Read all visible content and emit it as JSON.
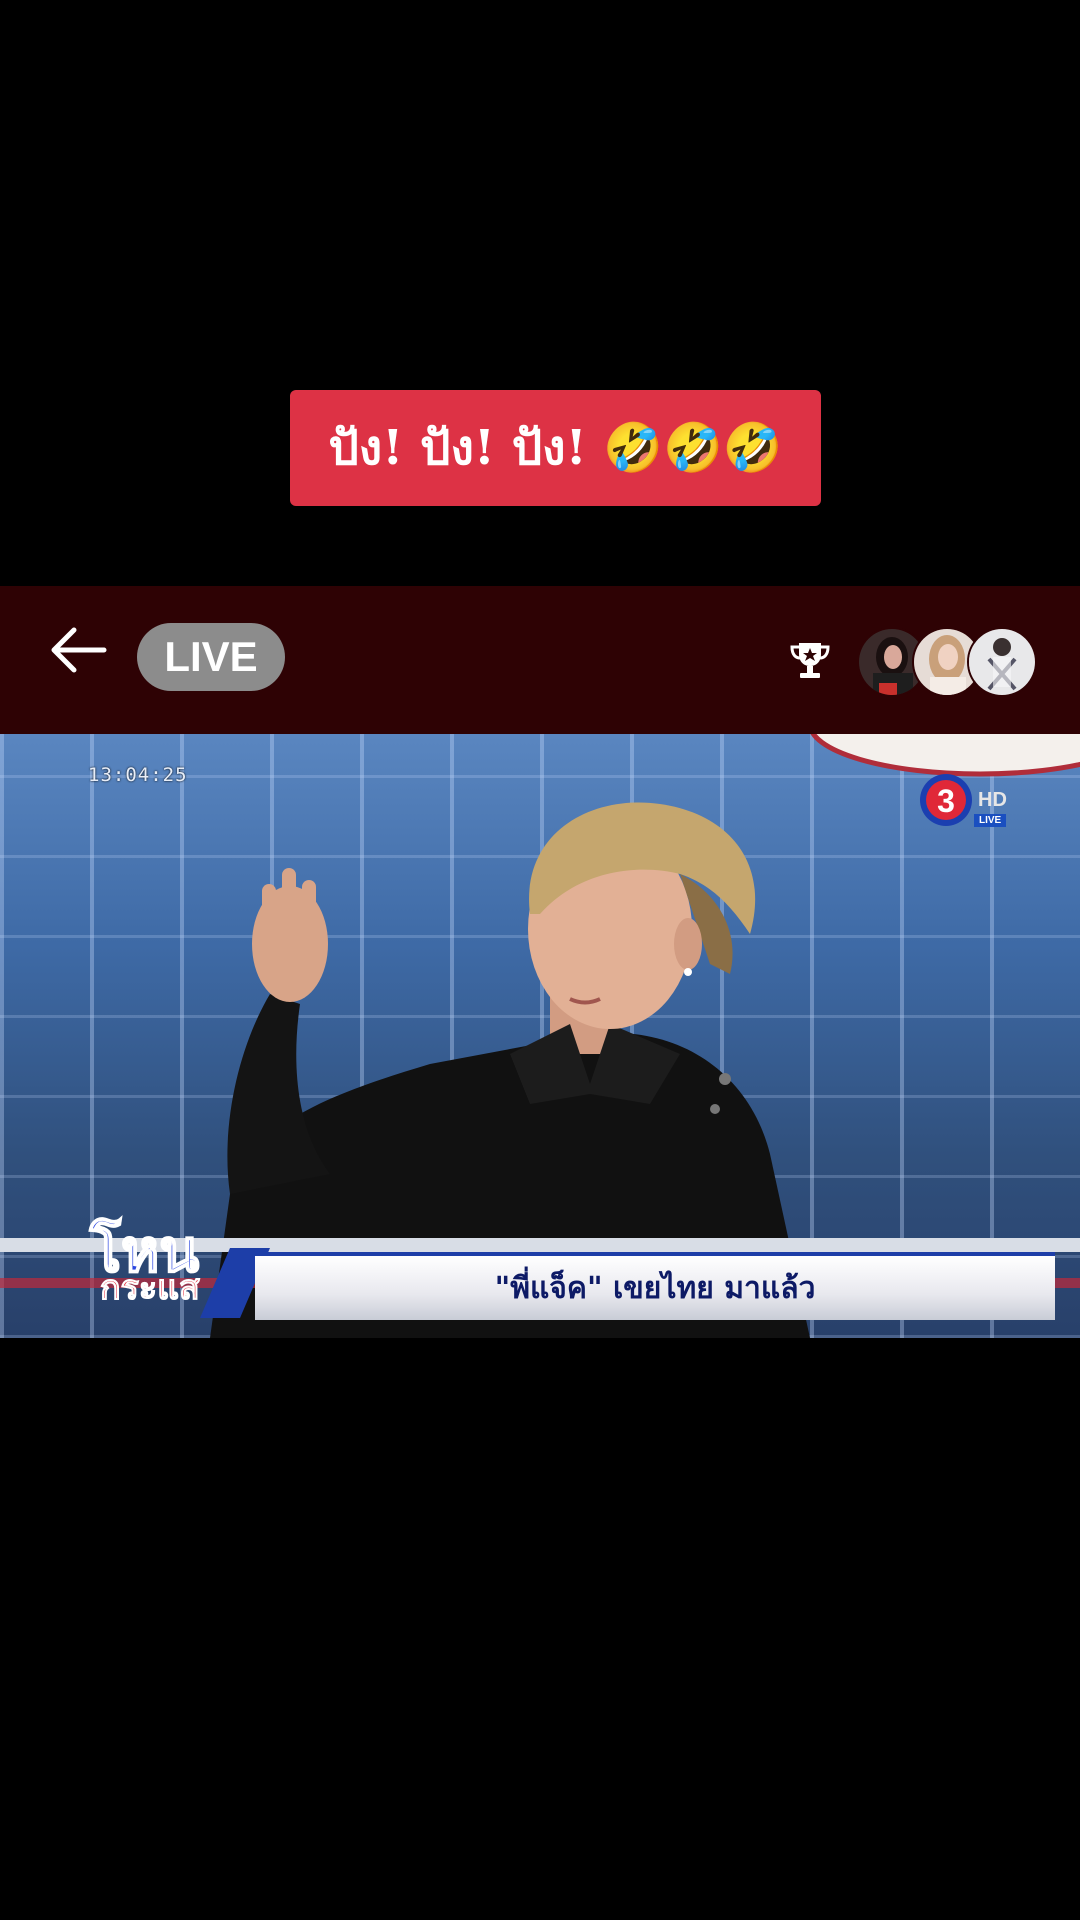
{
  "caption": {
    "text": "ปัง! ปัง! ปัง! 🤣🤣🤣"
  },
  "header": {
    "back_icon": "arrow-left-icon",
    "live_label": "LIVE",
    "trophy_icon": "trophy-icon",
    "viewers": [
      "viewer-avatar-1",
      "viewer-avatar-2",
      "viewer-avatar-3"
    ]
  },
  "video": {
    "timestamp": "13:04:25",
    "channel_badge": "LIVE",
    "show_logo_line1": "โหน",
    "show_logo_line2": "กระแส",
    "headline": "\"พี่แจ็ค\" เขยไทย มาแล้ว"
  },
  "colors": {
    "caption_bg": "#dd3245",
    "header_bg": "#2e0204",
    "live_pill": "#8c8c8c"
  }
}
